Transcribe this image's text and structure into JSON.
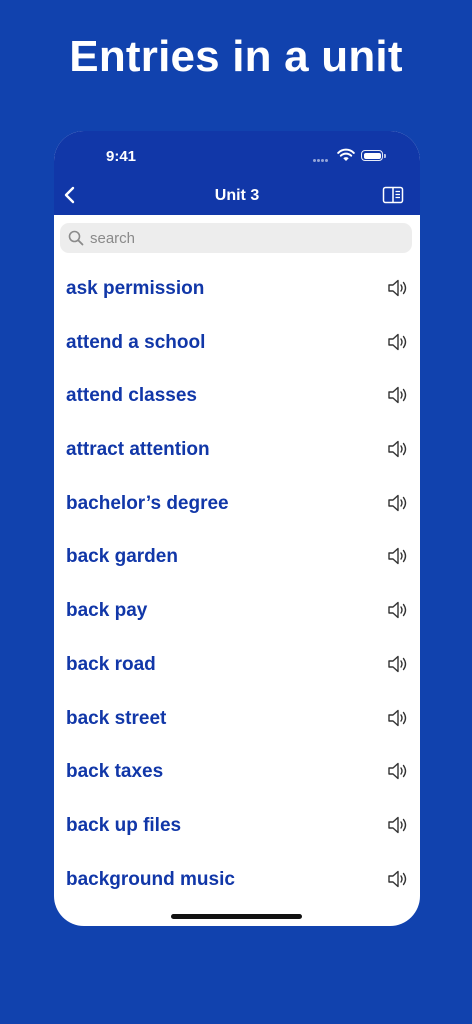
{
  "headline": "Entries in a unit",
  "status_bar": {
    "time": "9:41"
  },
  "nav": {
    "title": "Unit 3"
  },
  "search": {
    "placeholder": "search",
    "value": ""
  },
  "entries": [
    "ask permission",
    "attend a school",
    "attend classes",
    "attract attention",
    "bachelor’s degree",
    "back garden",
    "back pay",
    "back road",
    "back street",
    "back taxes",
    "back up files",
    "background music"
  ],
  "colors": {
    "background": "#1142ae",
    "nav_bar": "#1137a8",
    "entry_text": "#1137a8",
    "search_bg": "#ededed"
  },
  "icons": {
    "back": "chevron-left-icon",
    "sidebar": "sidebar-toggle-icon",
    "search": "magnifier-icon",
    "speaker": "speaker-icon"
  }
}
